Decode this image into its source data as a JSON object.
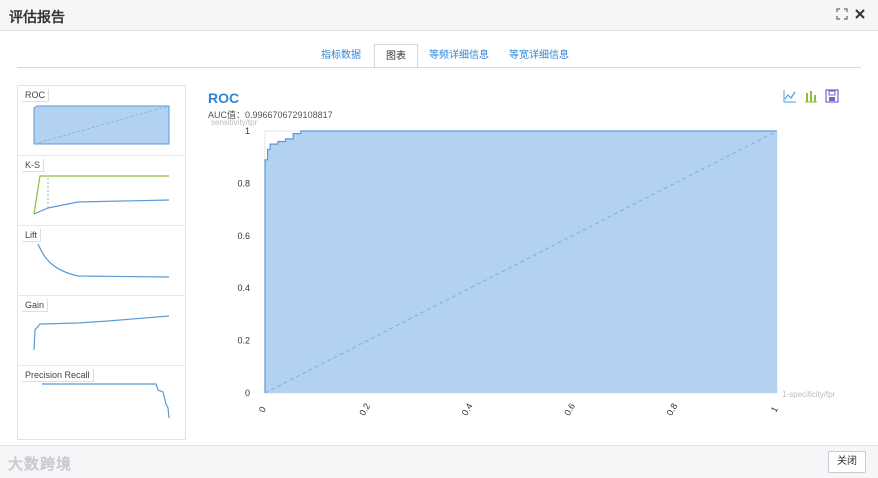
{
  "window": {
    "title": "评估报告"
  },
  "tabs": [
    {
      "label": "指标数据"
    },
    {
      "label": "图表"
    },
    {
      "label": "等频详细信息"
    },
    {
      "label": "等宽详细信息"
    }
  ],
  "thumbnails": [
    {
      "label": "ROC"
    },
    {
      "label": "K-S"
    },
    {
      "label": "Lift"
    },
    {
      "label": "Gain"
    },
    {
      "label": "Precision Recall"
    }
  ],
  "chart": {
    "title": "ROC",
    "auc_text": "AUC值：0.9966706729108817"
  },
  "chart_data": {
    "type": "area",
    "title": "ROC",
    "xlabel": "1-specificity/fpr",
    "ylabel": "sensitivity/tpr",
    "xlim": [
      0,
      1
    ],
    "ylim": [
      0,
      1
    ],
    "x_ticks": [
      "0",
      "0.2",
      "0.4",
      "0.6",
      "0.8",
      "1"
    ],
    "y_ticks": [
      "0",
      "0.2",
      "0.4",
      "0.6",
      "0.8",
      "1"
    ],
    "series": [
      {
        "x": [
          0,
          0,
          0.005,
          0.005,
          0.01,
          0.01,
          0.025,
          0.025,
          0.04,
          0.04,
          0.055,
          0.055,
          0.07,
          0.07,
          1
        ],
        "y": [
          0,
          0.89,
          0.89,
          0.93,
          0.93,
          0.95,
          0.95,
          0.96,
          0.96,
          0.97,
          0.97,
          0.99,
          0.99,
          1,
          1
        ]
      },
      {
        "x": [
          0,
          1
        ],
        "y": [
          0,
          1
        ]
      }
    ],
    "grid": true
  },
  "footer": {
    "watermark": "大数跨境",
    "close_label": "关闭"
  },
  "colors": {
    "accent": "#2f86d6",
    "area_fill": "#b3d1f1",
    "line": "#5b9bd5",
    "ks_green": "#8cbf3f"
  }
}
